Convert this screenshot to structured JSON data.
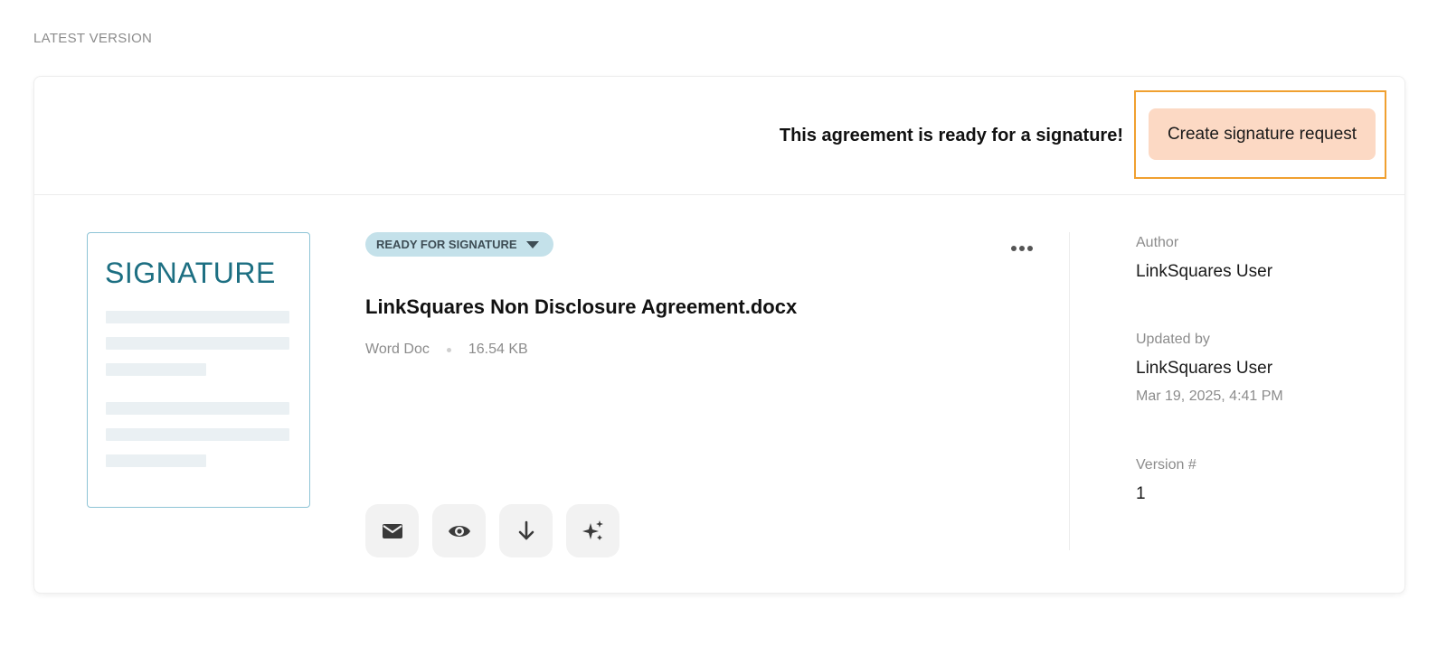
{
  "section": {
    "label": "LATEST VERSION"
  },
  "banner": {
    "message": "This agreement is ready for a signature!",
    "create_button_label": "Create signature request",
    "highlight_color": "#f0a030",
    "button_color": "#fcd9c4"
  },
  "document": {
    "thumbnail_title": "SIGNATURE",
    "status": "READY FOR SIGNATURE",
    "status_color": "#c4e1ea",
    "title": "LinkSquares Non Disclosure Agreement.docx",
    "file_type": "Word Doc",
    "file_size": "16.54 KB"
  },
  "actions": [
    {
      "name": "email",
      "icon": "envelope-icon"
    },
    {
      "name": "preview",
      "icon": "eye-icon"
    },
    {
      "name": "download",
      "icon": "download-arrow-icon"
    },
    {
      "name": "ai",
      "icon": "sparkles-icon"
    }
  ],
  "details": {
    "author_label": "Author",
    "author_value": "LinkSquares User",
    "updated_by_label": "Updated by",
    "updated_by_value": "LinkSquares User",
    "updated_at": "Mar 19, 2025, 4:41 PM",
    "version_label": "Version #",
    "version_value": "1"
  }
}
